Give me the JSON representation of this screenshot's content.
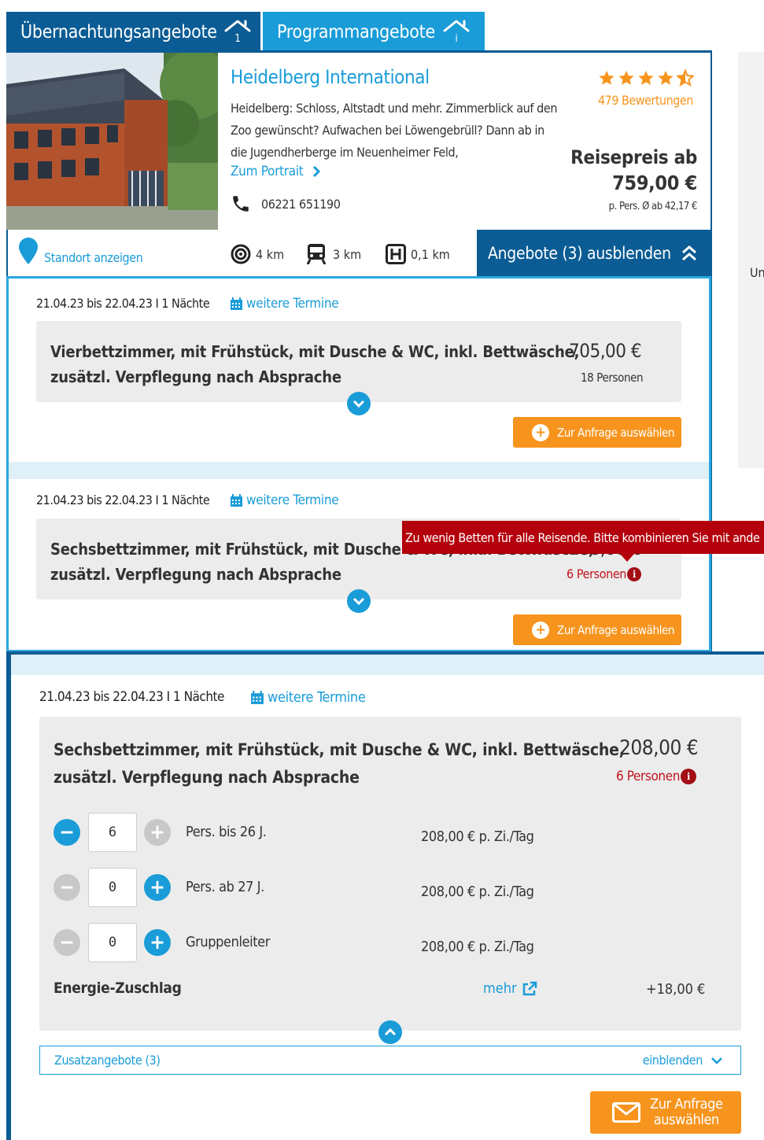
{
  "tabs": [
    {
      "label": "Übernachtungsangebote",
      "badge": "1"
    },
    {
      "label": "Programmangebote",
      "badge": "i"
    }
  ],
  "hotel": {
    "name": "Heidelberg International",
    "description": "Heidelberg: Schloss, Altstadt und mehr. Zimmerblick auf den Zoo gewünscht? Aufwachen bei Löwengebrüll? Dann ab in die Jugendherberge im Neuenheimer Feld,",
    "portrait_link": "Zum Portrait",
    "phone": "06221 651190",
    "rating": 4.5,
    "reviews": "479 Bewertungen",
    "price_label": "Reisepreis ab",
    "price": "759,00 €",
    "price_sub": "p. Pers. Ø ab 42,17 €"
  },
  "infobar": {
    "location_link": "Standort anzeigen",
    "distance_center": "4 km",
    "distance_train": "3 km",
    "distance_bus": "0,1 km",
    "offers_toggle": "Angebote (3) ausblenden"
  },
  "side_panel": {
    "text": "Un"
  },
  "offers": [
    {
      "date": "21.04.23 bis 22.04.23 I 1 Nächte",
      "more_dates": "weitere Termine",
      "title_line1": "Vierbettzimmer, mit Frühstück, mit Dusche & WC, inkl. Bettwäsche,",
      "title_line2": "zusätzl. Verpflegung nach Absprache",
      "price": "705,00 €",
      "persons": "18 Personen",
      "select_button": "Zur Anfrage auswählen"
    },
    {
      "date": "21.04.23 bis 22.04.23 I 1 Nächte",
      "more_dates": "weitere Termine",
      "title_line1": "Sechsbettzimmer, mit Frühstück, mit Dusche & WC, inkl. Bettwäsche,",
      "title_line2": "zusätzl. Verpflegung nach Absprache",
      "price": "208,00 €",
      "persons": "6 Personen",
      "select_button": "Zur Anfrage auswählen",
      "tooltip": "Zu wenig Betten für alle Reisende. Bitte kombinieren Sie mit ande"
    },
    {
      "date": "21.04.23 bis 22.04.23 I 1 Nächte",
      "more_dates": "weitere Termine",
      "title_line1": "Sechsbettzimmer, mit Frühstück, mit Dusche & WC, inkl. Bettwäsche,",
      "title_line2": "zusätzl. Verpflegung nach Absprache",
      "price": "208,00 €",
      "persons": "6 Personen",
      "guests": [
        {
          "label": "Pers. bis 26 J.",
          "count": "6",
          "rate": "208,00 € p. Zi./Tag"
        },
        {
          "label": "Pers. ab 27 J.",
          "count": "0",
          "rate": "208,00 € p. Zi./Tag"
        },
        {
          "label": "Gruppenleiter",
          "count": "0",
          "rate": "208,00 € p. Zi./Tag"
        }
      ],
      "surcharge_label": "Energie-Zuschlag",
      "surcharge_more": "mehr",
      "surcharge_price": "+18,00 €",
      "extras_label": "Zusatzangebote (3)",
      "extras_toggle": "einblenden",
      "select_button_line1": "Zur Anfrage",
      "select_button_line2": "auswählen"
    }
  ],
  "colors": {
    "brand_blue": "#0b5c94",
    "accent_blue": "#1a9cd8",
    "orange": "#f7941d",
    "error_red": "#b3000c"
  }
}
